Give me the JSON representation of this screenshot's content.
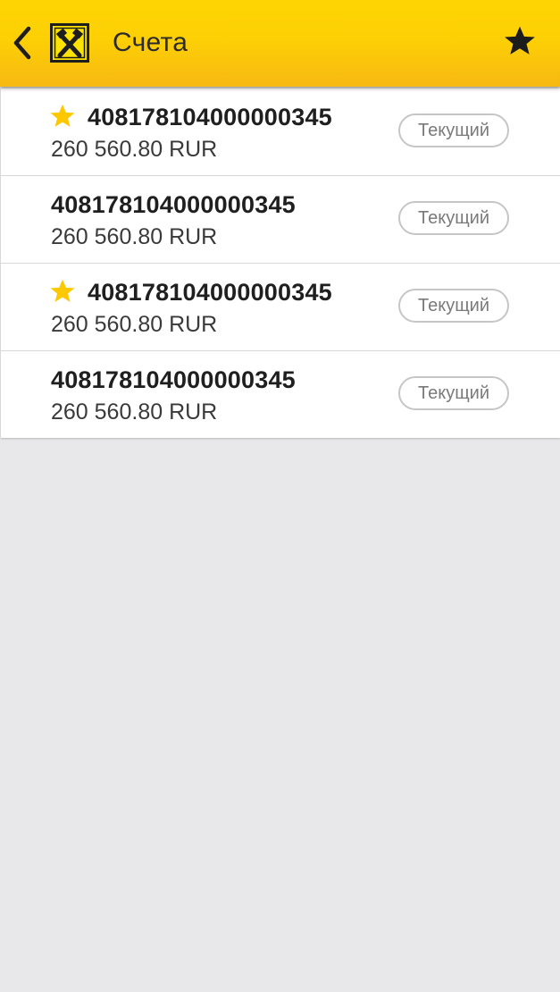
{
  "header": {
    "title": "Счета",
    "back_icon": "chevron-left-icon",
    "logo": "bank-logo",
    "favorite_icon": "star-icon",
    "background_color": "#fdd005"
  },
  "accounts": [
    {
      "number": "408178104000000345",
      "balance": "260 560.80 RUR",
      "type": "Текущий",
      "favorite": true
    },
    {
      "number": "408178104000000345",
      "balance": "260 560.80 RUR",
      "type": "Текущий",
      "favorite": false
    },
    {
      "number": "408178104000000345",
      "balance": "260 560.80 RUR",
      "type": "Текущий",
      "favorite": true
    },
    {
      "number": "408178104000000345",
      "balance": "260 560.80 RUR",
      "type": "Текущий",
      "favorite": false
    }
  ],
  "colors": {
    "favorite_star": "#fdc800",
    "header_star": "#1c1c1c",
    "page_background": "#e8e8ea"
  }
}
